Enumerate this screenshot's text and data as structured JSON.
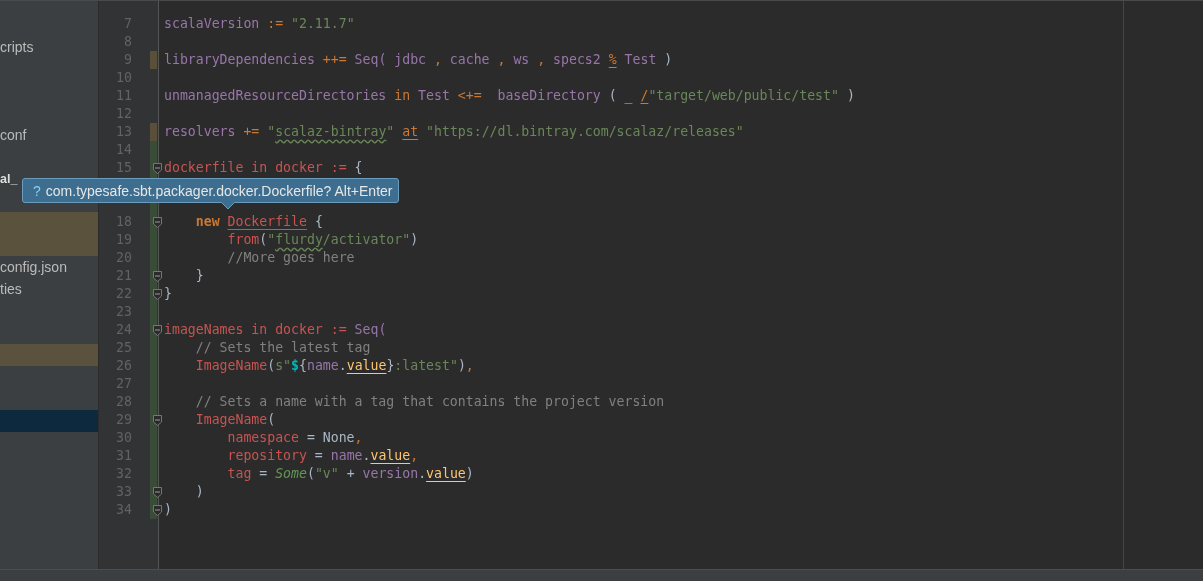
{
  "sidebar": {
    "rows": [
      {
        "label": "cripts",
        "bold": false,
        "selected": false,
        "modified": false
      },
      {
        "selected": false,
        "modified": false
      },
      {
        "selected": false,
        "modified": false
      },
      {
        "selected": false,
        "modified": false
      },
      {
        "label": "conf",
        "bold": false,
        "selected": false,
        "modified": false
      },
      {
        "selected": false,
        "modified": false
      },
      {
        "label": "al_",
        "bold": true,
        "selected": false,
        "modified": false
      },
      {
        "selected": false,
        "modified": false
      },
      {
        "selected": false,
        "modified": true
      },
      {
        "selected": false,
        "modified": true
      },
      {
        "label": "config.json",
        "bold": false,
        "selected": false,
        "modified": false
      },
      {
        "label": "ties",
        "bold": false,
        "selected": false,
        "modified": false
      },
      {
        "selected": false,
        "modified": false
      },
      {
        "selected": false,
        "modified": false
      },
      {
        "selected": false,
        "modified": true
      },
      {
        "selected": false,
        "modified": false
      },
      {
        "selected": false,
        "modified": false
      },
      {
        "selected": true,
        "modified": false
      }
    ]
  },
  "editor": {
    "lines": [
      {
        "number": "7",
        "modified": false,
        "added": false,
        "fold": false,
        "tokens": [
          {
            "text": "scalaVersion",
            "kind": "field"
          },
          {
            "text": " :=",
            "kind": "op"
          },
          {
            "text": " \"2.11.7\"",
            "kind": "str"
          }
        ]
      },
      {
        "number": "8",
        "modified": false,
        "added": false,
        "fold": false
      },
      {
        "number": "9",
        "modified": true,
        "added": false,
        "fold": false,
        "tokens": [
          {
            "text": "libraryDependencies",
            "kind": "field"
          },
          {
            "text": " ++=",
            "kind": "op"
          },
          {
            "text": " Seq( jdbc ",
            "kind": "field"
          },
          {
            "text": ",",
            "kind": "op"
          },
          {
            "text": " cache ",
            "kind": "field"
          },
          {
            "text": ",",
            "kind": "op"
          },
          {
            "text": " ws ",
            "kind": "field"
          },
          {
            "text": ",",
            "kind": "op"
          },
          {
            "text": " specs2 ",
            "kind": "field"
          },
          {
            "text": "%",
            "kind": "op_u"
          },
          {
            "text": " Test ",
            "kind": "field"
          },
          {
            "text": ")",
            "kind": "plain"
          }
        ]
      },
      {
        "number": "10",
        "modified": false,
        "added": false,
        "fold": false
      },
      {
        "number": "11",
        "modified": false,
        "added": false,
        "fold": false,
        "tokens": [
          {
            "text": "unmanagedResourceDirectories",
            "kind": "field"
          },
          {
            "text": " in",
            "kind": "op"
          },
          {
            "text": " Test ",
            "kind": "field"
          },
          {
            "text": "<+=",
            "kind": "op"
          },
          {
            "text": "  baseDirectory ",
            "kind": "field"
          },
          {
            "text": "( _ ",
            "kind": "plain"
          },
          {
            "text": "/",
            "kind": "op_u"
          },
          {
            "text": "\"target/web/public/test\"",
            "kind": "str"
          },
          {
            "text": " )",
            "kind": "plain"
          }
        ]
      },
      {
        "number": "12",
        "modified": false,
        "added": false,
        "fold": false
      },
      {
        "number": "13",
        "modified": true,
        "added": false,
        "fold": false,
        "tokens": [
          {
            "text": "resolvers",
            "kind": "field"
          },
          {
            "text": " +=",
            "kind": "op"
          },
          {
            "text": " \"",
            "kind": "str"
          },
          {
            "text": "scalaz-bintray",
            "kind": "str_sq"
          },
          {
            "text": "\" ",
            "kind": "str"
          },
          {
            "text": "at",
            "kind": "op_u"
          },
          {
            "text": " \"https://dl.bintray.com/scalaz/releases\"",
            "kind": "str"
          }
        ]
      },
      {
        "number": "14",
        "modified": false,
        "added": true,
        "fold": false
      },
      {
        "number": "15",
        "modified": false,
        "added": true,
        "fold": true,
        "tokens": [
          {
            "text": "dockerfile in docker := ",
            "kind": "err"
          },
          {
            "text": "{",
            "kind": "plain"
          }
        ]
      },
      {
        "modified": false,
        "added": true,
        "fold": false
      },
      {
        "modified": false,
        "added": true,
        "fold": false
      },
      {
        "number": "18",
        "modified": false,
        "added": true,
        "fold": true,
        "tokens": [
          {
            "text": "    new ",
            "kind": "kw"
          },
          {
            "text": "Dockerfile",
            "kind": "err_u"
          },
          {
            "text": " {",
            "kind": "plain"
          }
        ]
      },
      {
        "number": "19",
        "modified": false,
        "added": true,
        "fold": false,
        "tokens": [
          {
            "text": "        from",
            "kind": "err"
          },
          {
            "text": "(",
            "kind": "plain"
          },
          {
            "text": "\"",
            "kind": "str"
          },
          {
            "text": "flurdy",
            "kind": "str_sq"
          },
          {
            "text": "/activator\"",
            "kind": "str"
          },
          {
            "text": ")",
            "kind": "plain"
          }
        ]
      },
      {
        "number": "20",
        "modified": false,
        "added": true,
        "fold": false,
        "tokens": [
          {
            "text": "        //More goes here",
            "kind": "comment"
          }
        ]
      },
      {
        "number": "21",
        "modified": false,
        "added": true,
        "fold": true,
        "tokens": [
          {
            "text": "    }",
            "kind": "plain"
          }
        ]
      },
      {
        "number": "22",
        "modified": false,
        "added": true,
        "fold": true,
        "tokens": [
          {
            "text": "}",
            "kind": "plain"
          }
        ]
      },
      {
        "number": "23",
        "modified": false,
        "added": true,
        "fold": false
      },
      {
        "number": "24",
        "modified": false,
        "added": true,
        "fold": true,
        "tokens": [
          {
            "text": "imageNames in docker := ",
            "kind": "err"
          },
          {
            "text": "Seq(",
            "kind": "field"
          }
        ]
      },
      {
        "number": "25",
        "modified": false,
        "added": true,
        "fold": false,
        "tokens": [
          {
            "text": "    // Sets the latest tag",
            "kind": "comment"
          }
        ]
      },
      {
        "number": "26",
        "modified": false,
        "added": true,
        "fold": false,
        "tokens": [
          {
            "text": "    ImageName",
            "kind": "err"
          },
          {
            "text": "(",
            "kind": "plain"
          },
          {
            "text": "s\"",
            "kind": "str"
          },
          {
            "text": "$",
            "kind": "interp"
          },
          {
            "text": "{",
            "kind": "plain"
          },
          {
            "text": "name",
            "kind": "field"
          },
          {
            "text": ".",
            "kind": "plain"
          },
          {
            "text": "value",
            "kind": "method_u"
          },
          {
            "text": "}",
            "kind": "plain"
          },
          {
            "text": ":latest\"",
            "kind": "str"
          },
          {
            "text": ")",
            "kind": "plain"
          },
          {
            "text": ",",
            "kind": "op"
          }
        ]
      },
      {
        "number": "27",
        "modified": false,
        "added": true,
        "fold": false
      },
      {
        "number": "28",
        "modified": false,
        "added": true,
        "fold": false,
        "tokens": [
          {
            "text": "    // Sets a name with a tag that contains the project version",
            "kind": "comment"
          }
        ]
      },
      {
        "number": "29",
        "modified": false,
        "added": true,
        "fold": true,
        "tokens": [
          {
            "text": "    ImageName",
            "kind": "err"
          },
          {
            "text": "(",
            "kind": "plain"
          }
        ]
      },
      {
        "number": "30",
        "modified": false,
        "added": true,
        "fold": false,
        "tokens": [
          {
            "text": "        namespace",
            "kind": "err"
          },
          {
            "text": " = None",
            "kind": "plain"
          },
          {
            "text": ",",
            "kind": "op"
          }
        ]
      },
      {
        "number": "31",
        "modified": false,
        "added": true,
        "fold": false,
        "tokens": [
          {
            "text": "        repository",
            "kind": "err"
          },
          {
            "text": " = ",
            "kind": "plain"
          },
          {
            "text": "name",
            "kind": "field"
          },
          {
            "text": ".",
            "kind": "plain"
          },
          {
            "text": "value",
            "kind": "method_u"
          },
          {
            "text": ",",
            "kind": "op"
          }
        ]
      },
      {
        "number": "32",
        "modified": false,
        "added": true,
        "fold": false,
        "tokens": [
          {
            "text": "        tag",
            "kind": "err"
          },
          {
            "text": " = ",
            "kind": "plain"
          },
          {
            "text": "Some",
            "kind": "italic"
          },
          {
            "text": "(",
            "kind": "plain"
          },
          {
            "text": "\"v\"",
            "kind": "str"
          },
          {
            "text": " + ",
            "kind": "plain"
          },
          {
            "text": "version",
            "kind": "field"
          },
          {
            "text": ".",
            "kind": "plain"
          },
          {
            "text": "value",
            "kind": "method_u"
          },
          {
            "text": ")",
            "kind": "plain"
          }
        ]
      },
      {
        "number": "33",
        "modified": false,
        "added": true,
        "fold": true,
        "tokens": [
          {
            "text": "    )",
            "kind": "plain"
          }
        ]
      },
      {
        "number": "34",
        "modified": false,
        "added": true,
        "fold": true,
        "tokens": [
          {
            "text": ")",
            "kind": "plain"
          }
        ]
      }
    ]
  },
  "tooltip": {
    "icon": "?",
    "text": "com.typesafe.sbt.packager.docker.Dockerfile? Alt+Enter"
  }
}
